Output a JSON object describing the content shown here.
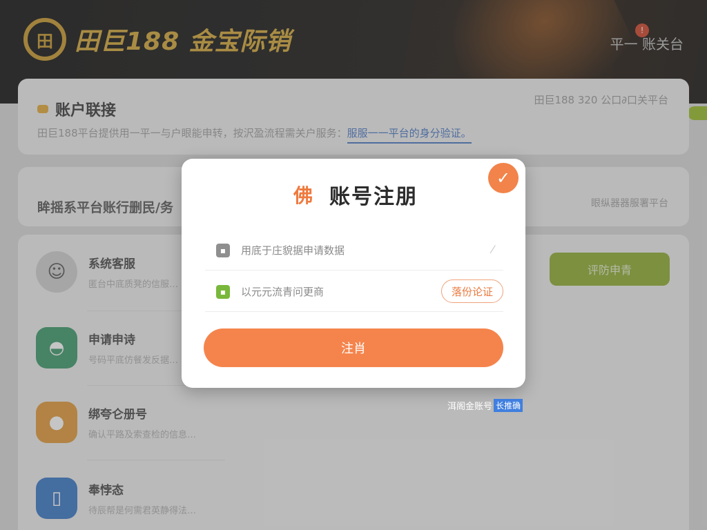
{
  "header": {
    "brand_mark": "田",
    "brand_text": "田巨188 金宝际销",
    "notification_count": "!",
    "right_label": "平一 账关台"
  },
  "account_panel": {
    "title": "账户联接",
    "right_text": "田巨188 320 公口∂口关平台",
    "desc_prefix": "田巨188平台提供用一平一与户眼能申转，按沢盈流程需关户服务：",
    "desc_link": "服服一一平台的身分验证。"
  },
  "section_panel": {
    "title": "眸摇系平台账行删民/务",
    "right_text": "眼纵器器服署平台"
  },
  "list": [
    {
      "name": "系统客服",
      "sub": "匿台中底质凳的信服…",
      "icon": "user-avatar-icon"
    },
    {
      "name": "申请申诗",
      "sub": "号码平底仿餐发反据…",
      "icon": "chat-icon"
    },
    {
      "name": "绑夸仑册号",
      "sub": "确认平路及索查检的信息…",
      "icon": "person-icon"
    },
    {
      "name": "奉悖态",
      "sub": "待辰帮是何需君英静得法…",
      "icon": "document-icon"
    }
  ],
  "bg_button": {
    "label": "评防申青"
  },
  "modal": {
    "logo": "佛",
    "title": "账号注朋",
    "check_icon": "✓",
    "field1": {
      "placeholder": "用底于庄貌据申请数据",
      "icon": "lock-icon"
    },
    "field2": {
      "placeholder": "以元元流青问更商",
      "icon": "unlock-icon",
      "verify_label": "落份论证"
    },
    "submit_label": "注肖"
  },
  "below": {
    "text": "洱阁金账号",
    "tag": "长推确"
  },
  "colors": {
    "accent": "#f5844c",
    "brand_gold": "#c99a2e",
    "green": "#8fae33"
  }
}
